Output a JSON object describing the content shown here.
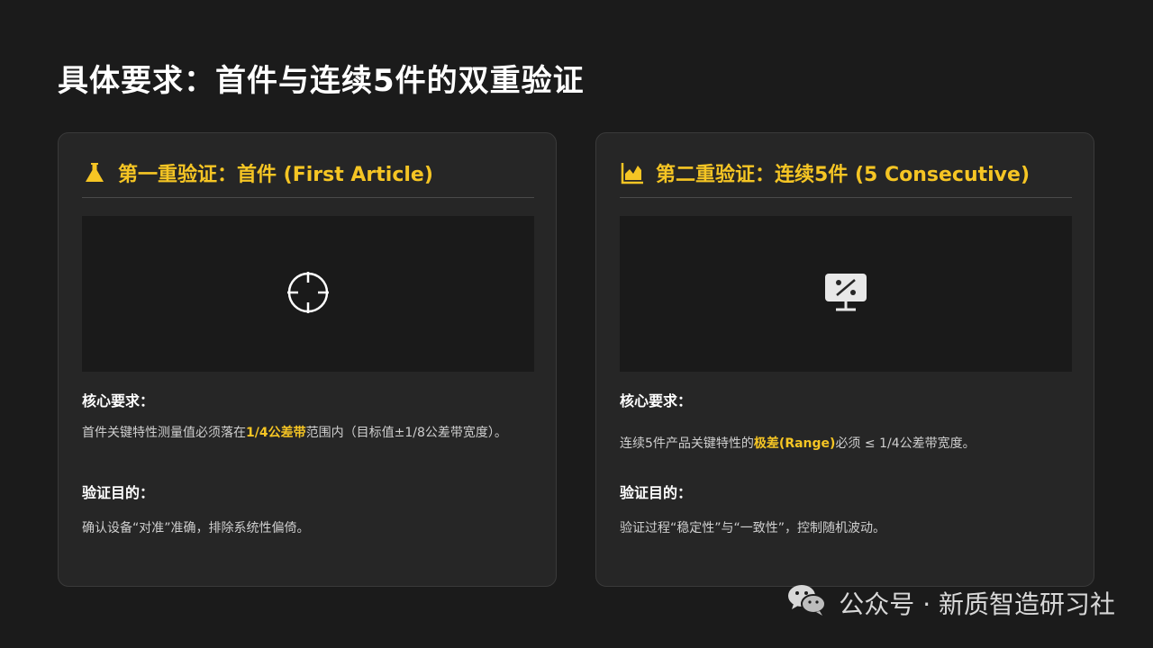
{
  "page": {
    "title": "具体要求：首件与连续5件的双重验证"
  },
  "cards": [
    {
      "header_icon": "flask-icon",
      "title": "第一重验证：首件 (First Article)",
      "media_icon": "crosshair-icon",
      "requirement_label": "核心要求：",
      "requirement_before": "首件关键特性测量值必须落在",
      "requirement_highlight": "1/4公差带",
      "requirement_after": "范围内（目标值±1/8公差带宽度）。",
      "purpose_label": "验证目的：",
      "purpose_text": "确认设备“对准”准确，排除系统性偏倚。"
    },
    {
      "header_icon": "area-chart-icon",
      "title": "第二重验证：连续5件 (5 Consecutive)",
      "media_icon": "monitor-percent-icon",
      "requirement_label": "核心要求：",
      "requirement_before": "连续5件产品关键特性的",
      "requirement_highlight": "极差(Range)",
      "requirement_after": "必须 ≤ 1/4公差带宽度。",
      "purpose_label": "验证目的：",
      "purpose_text": "验证过程“稳定性”与“一致性”，控制随机波动。"
    }
  ],
  "footer": {
    "text": "公众号 · 新质智造研习社",
    "icon": "wechat-icon"
  },
  "colors": {
    "background": "#1b1b1b",
    "card": "#262626",
    "accent": "#f5c524"
  }
}
